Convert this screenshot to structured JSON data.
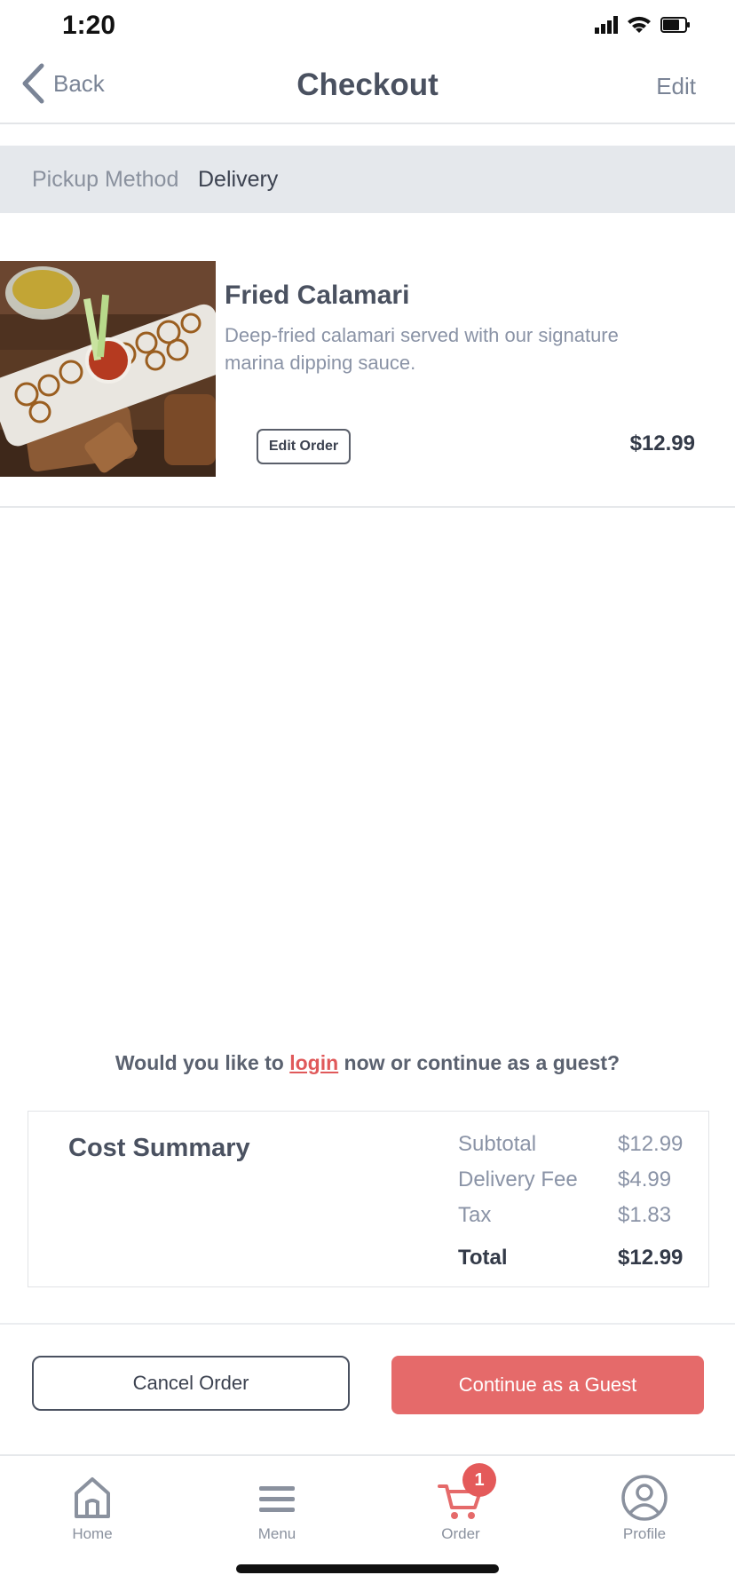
{
  "status_bar": {
    "time": "1:20"
  },
  "header": {
    "back_label": "Back",
    "title": "Checkout",
    "edit_label": "Edit"
  },
  "method": {
    "label": "Pickup Method",
    "value": "Delivery"
  },
  "item": {
    "name": "Fried Calamari",
    "description": "Deep-fried calamari served with our signature marina dipping sauce.",
    "edit_label": "Edit Order",
    "price": "$12.99"
  },
  "login_prompt": {
    "before": "Would you like to ",
    "link": "login",
    "after": " now or continue as a guest?"
  },
  "cost_summary": {
    "title": "Cost Summary",
    "rows": [
      {
        "label": "Subtotal",
        "value": "$12.99"
      },
      {
        "label": "Delivery Fee",
        "value": "$4.99"
      },
      {
        "label": "Tax",
        "value": "$1.83"
      }
    ],
    "total": {
      "label": "Total",
      "value": "$12.99"
    }
  },
  "actions": {
    "cancel_label": "Cancel Order",
    "guest_label": "Continue as a Guest"
  },
  "tabs": [
    {
      "label": "Home",
      "icon": "home-icon"
    },
    {
      "label": "Menu",
      "icon": "menu-icon"
    },
    {
      "label": "Order",
      "icon": "cart-icon",
      "badge": "1"
    },
    {
      "label": "Profile",
      "icon": "profile-icon"
    }
  ],
  "colors": {
    "accent": "#e56a6a",
    "text": "#4a5160",
    "muted": "#8a93a6"
  }
}
